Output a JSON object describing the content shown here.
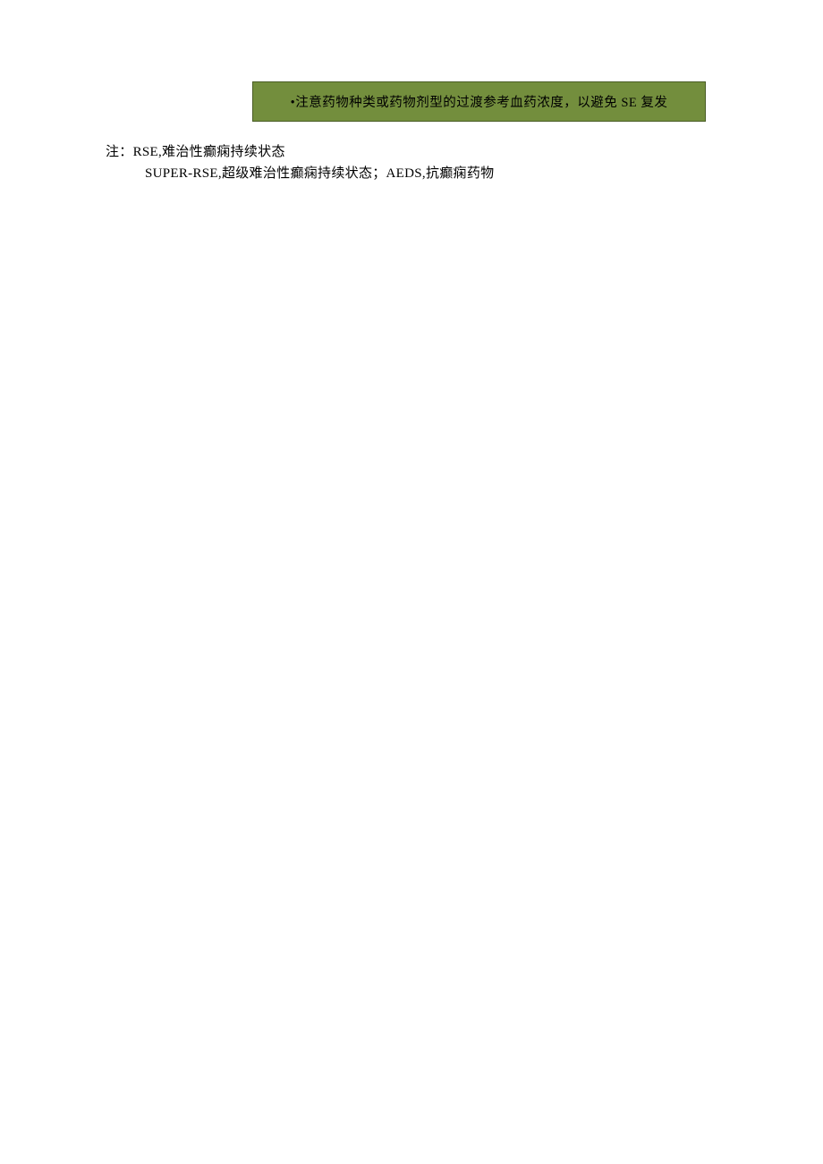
{
  "callout": {
    "text": "•注意药物种类或药物剂型的过渡参考血药浓度，以避免 SE 复发"
  },
  "notes": {
    "line1": "注：RSE,难治性癫痫持续状态",
    "line2": "SUPER-RSE,超级难治性癫痫持续状态；AEDS,抗癫痫药物"
  }
}
